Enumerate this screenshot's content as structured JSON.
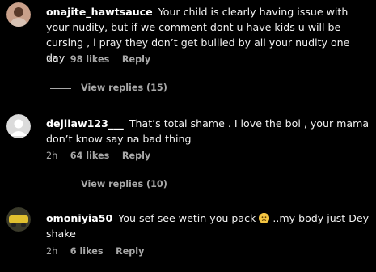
{
  "comments": [
    {
      "username": "onajite_hawtsauce",
      "text": "Your child is clearly having issue with your nudity, but if we comment dont u have kids u will be cursing , i pray they don’t get bullied by all your nudity one day",
      "time": "2h",
      "likes": "98 likes",
      "reply": "Reply",
      "view_replies": "View replies (15)"
    },
    {
      "username": "dejilaw123___",
      "text": "That’s total shame . I love the boi , your mama don’t know say na bad thing",
      "time": "2h",
      "likes": "64 likes",
      "reply": "Reply",
      "view_replies": "View replies (10)"
    },
    {
      "username": "omoniyia50",
      "text_before": "You sef see wetin you pack",
      "emoji": "sad-face-emoji",
      "text_after": "..my body just Dey shake",
      "time": "2h",
      "likes": "6 likes",
      "reply": "Reply"
    }
  ],
  "colors": {
    "background": "#000000",
    "text": "#f2f2f2",
    "secondary": "#a8a8a8"
  }
}
